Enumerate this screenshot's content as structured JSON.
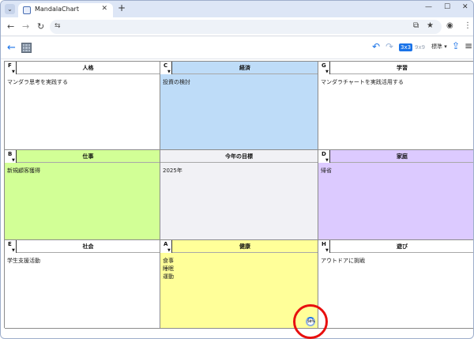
{
  "browser": {
    "tab_title": "MandalaChart",
    "tab_menu": "⌄",
    "new_tab": "+",
    "win_minimize": "—",
    "win_maximize": "☐",
    "win_close": "✕",
    "tab_close": "✕"
  },
  "toolbar": {
    "back": "←",
    "forward": "→",
    "reload": "↻",
    "site_info": "⇆",
    "install_icon": "⧉",
    "bookmark": "★",
    "profile": "◉",
    "more": "⋮"
  },
  "app": {
    "back": "←",
    "undo": "↶",
    "redo": "↷",
    "size_3x3": "3x3",
    "size_9x9": "9x9",
    "mode_label": "標準 ▾",
    "share": "⇪",
    "menu": "≡"
  },
  "cells": [
    {
      "letter": "F",
      "title": "人格",
      "lines": [
        "マンダラ思考を実践する"
      ],
      "color": "#ffffff",
      "head_color": "#ffffff"
    },
    {
      "letter": "C",
      "title": "経済",
      "lines": [
        "投資の検討"
      ],
      "color": "#bedcf8",
      "head_color": "#bedcf8"
    },
    {
      "letter": "G",
      "title": "学習",
      "lines": [
        "マンダラチャートを実践活用する"
      ],
      "color": "#ffffff",
      "head_color": "#ffffff"
    },
    {
      "letter": "B",
      "title": "仕事",
      "lines": [
        "新規顧客獲得"
      ],
      "color": "#d2ff96",
      "head_color": "#d2ff96"
    },
    {
      "letter": "",
      "title": "今年の目標",
      "lines": [
        "2025年"
      ],
      "color": "#f1f1f5",
      "head_color": "#f1f1f5"
    },
    {
      "letter": "D",
      "title": "家庭",
      "lines": [
        "帰省"
      ],
      "color": "#dccaff",
      "head_color": "#dccaff"
    },
    {
      "letter": "E",
      "title": "社会",
      "lines": [
        "学生支援活動"
      ],
      "color": "#ffffff",
      "head_color": "#ffffff"
    },
    {
      "letter": "A",
      "title": "健康",
      "lines": [
        "食事",
        "睡眠",
        "運動"
      ],
      "color": "#ffff99",
      "head_color": "#ffff99",
      "progress": "50%"
    },
    {
      "letter": "H",
      "title": "遊び",
      "lines": [
        "アウトドアに挑戦"
      ],
      "color": "#ffffff",
      "head_color": "#ffffff"
    }
  ]
}
